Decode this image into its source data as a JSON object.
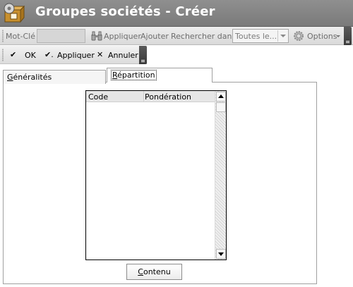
{
  "window": {
    "title": "Groupes sociétés - Créer",
    "app_icon": "box-gear-icon"
  },
  "search_toolbar": {
    "keyword_label": "Mot-Clé",
    "keyword_value": "",
    "apply_label": "Appliquer",
    "add_label": "Ajouter",
    "search_in_label": "Rechercher dans",
    "search_in_value": "Toutes le...",
    "options_label": "Options",
    "icons": [
      "binoculars-icon",
      "gear-icon",
      "chevron-down-icon"
    ]
  },
  "action_toolbar": {
    "ok_label": "OK",
    "apply_label": "Appliquer",
    "cancel_label": "Annuler",
    "icons": [
      "check-icon",
      "check-dot-icon",
      "close-icon"
    ]
  },
  "tabs": [
    {
      "first": "G",
      "rest": "énéralités",
      "selected": false
    },
    {
      "first": "R",
      "rest": "épartition",
      "selected": true
    }
  ],
  "grid": {
    "columns": [
      "Code",
      "Pondération"
    ],
    "rows": []
  },
  "contenu_button": {
    "first": "C",
    "rest": "ontenu"
  },
  "colors": {
    "titlebar": "#808080",
    "title_text": "#ffffff",
    "toolbar": "#e4e4e4",
    "overflow": "#4a4a4a"
  }
}
